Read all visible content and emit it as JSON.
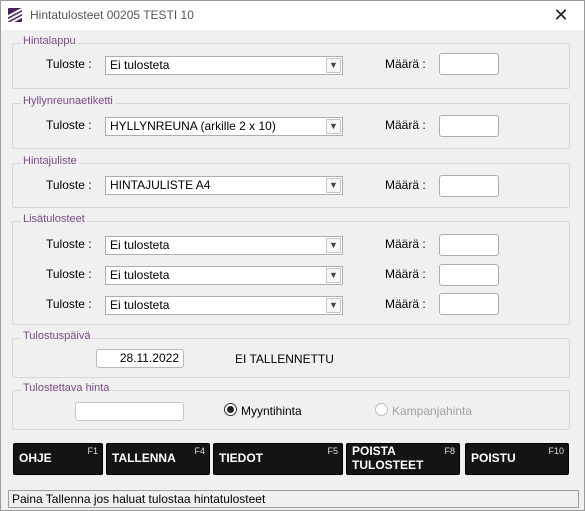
{
  "window": {
    "title": "Hintatulosteet 00205 TESTI 10",
    "close_glyph": "✕",
    "accent_color": "#7b4a86"
  },
  "hintalappu": {
    "legend": "Hintalappu",
    "tuloste_label": "Tuloste :",
    "select_value": "Ei tulosteta",
    "maara_label": "Määrä :"
  },
  "hyllynreunaetiketti": {
    "legend": "Hyllynreunaetiketti",
    "tuloste_label": "Tuloste :",
    "select_value": "HYLLYNREUNA (arkille 2 x 10)",
    "maara_label": "Määrä :"
  },
  "hintajuliste": {
    "legend": "Hintajuliste",
    "tuloste_label": "Tuloste :",
    "select_value": "HINTAJULISTE A4",
    "maara_label": "Määrä :"
  },
  "lisatulosteet": {
    "legend": "Lisätulosteet",
    "rows": [
      {
        "tuloste_label": "Tuloste :",
        "select_value": "Ei tulosteta",
        "maara_label": "Määrä :"
      },
      {
        "tuloste_label": "Tuloste :",
        "select_value": "Ei tulosteta",
        "maara_label": "Määrä :"
      },
      {
        "tuloste_label": "Tuloste :",
        "select_value": "Ei tulosteta",
        "maara_label": "Määrä :"
      }
    ]
  },
  "tulostuspaiva": {
    "legend": "Tulostuspäivä",
    "date_value": "28.11.2022",
    "status_text": "EI TALLENNETTU"
  },
  "tulostettava_hinta": {
    "legend": "Tulostettava hinta",
    "price_value": "",
    "option_myyntihinta": "Myyntihinta",
    "option_kampanjahinta": "Kampanjahinta",
    "selected": "Myyntihinta"
  },
  "buttons": {
    "ohje": {
      "label": "OHJE",
      "fkey": "F1"
    },
    "tallenna": {
      "label": "TALLENNA",
      "fkey": "F4"
    },
    "tiedot": {
      "label": "TIEDOT",
      "fkey": "F5"
    },
    "poista_line1": "POISTA",
    "poista_line2": "TULOSTEET",
    "poista_fkey": "F8",
    "poistu": {
      "label": "POISTU",
      "fkey": "F10"
    }
  },
  "statusbar": {
    "text": "Paina Tallenna jos haluat tulostaa hintatulosteet"
  }
}
